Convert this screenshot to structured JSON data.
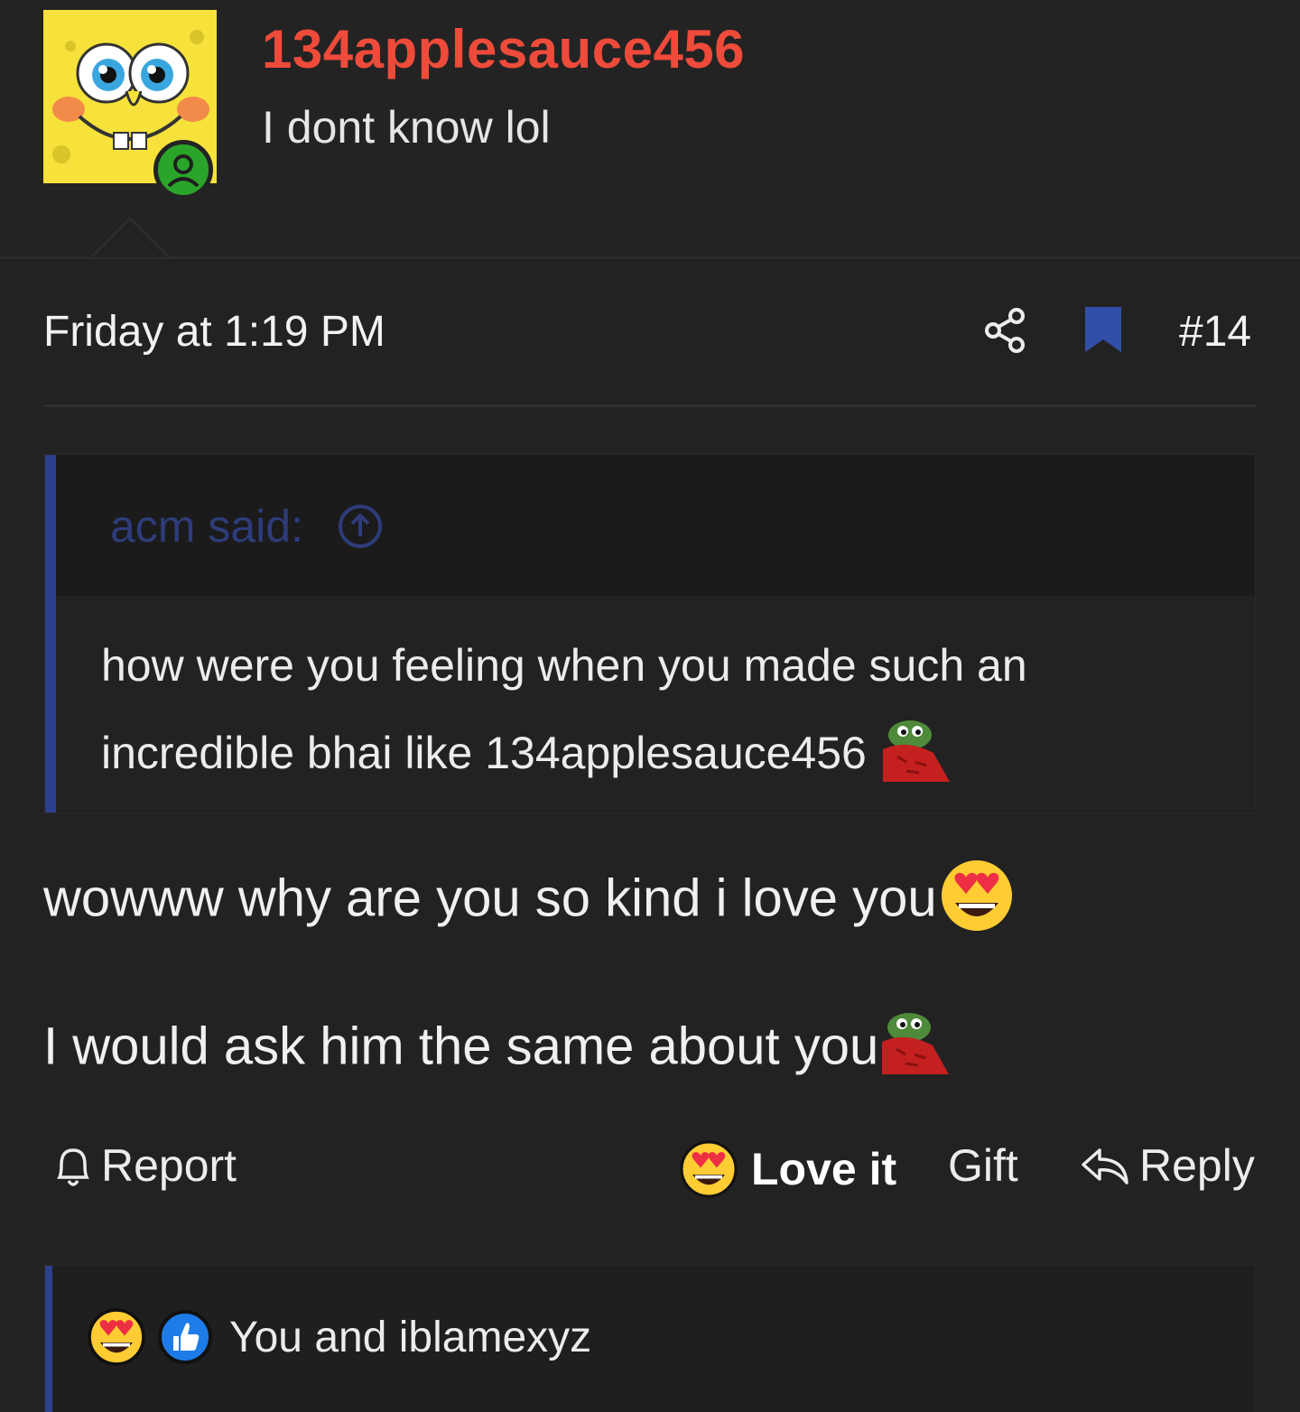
{
  "post": {
    "username": "134applesauce456",
    "user_title": "I dont know lol",
    "avatar_icon": "spongebob-avatar-icon",
    "online_status_icon": "online-user-icon",
    "date": "Friday at 1:19 PM",
    "number": "#14",
    "share_icon": "share-icon",
    "bookmark_icon": "bookmark-icon"
  },
  "quote": {
    "author": "acm said:",
    "line1": "how were you feeling when you made such an",
    "line2": "incredible bhai like 134applesauce456",
    "emoji": "pepe-blanket-icon"
  },
  "message": {
    "line1": "wowww why are you so kind i love you",
    "line1_emoji": "heart-eyes-emoji-icon",
    "line2": "I would ask him the same about you",
    "line2_emoji": "pepe-blanket-icon"
  },
  "actions": {
    "report": "Report",
    "love_it": "Love it",
    "gift": "Gift",
    "reply": "Reply"
  },
  "reactions": {
    "summary": "You and iblamexyz",
    "icons": [
      "heart-eyes-emoji-icon",
      "thumbs-up-icon"
    ]
  },
  "colors": {
    "background": "#222222",
    "username": "#ee4b3b",
    "accent_blue": "#2d3f8f",
    "bookmark": "#2f4fa8",
    "online": "#2aa52a"
  }
}
